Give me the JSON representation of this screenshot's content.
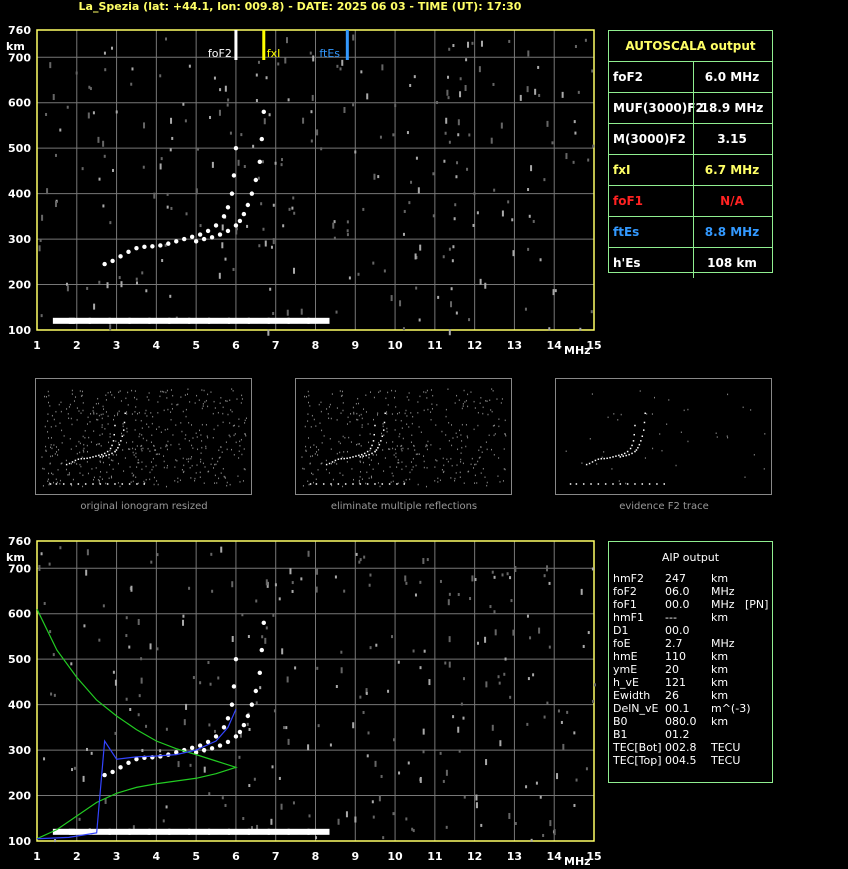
{
  "header": {
    "title": "La_Spezia (lat: +44.1, lon: 009.8) - DATE: 2025 06 03 - TIME (UT): 17:30"
  },
  "axes": {
    "x_label": "MHz",
    "y_label": "km",
    "x_ticks": [
      "1",
      "2",
      "3",
      "4",
      "5",
      "6",
      "7",
      "8",
      "9",
      "10",
      "11",
      "12",
      "13",
      "14",
      "15"
    ],
    "y_ticks": [
      "100",
      "200",
      "300",
      "400",
      "500",
      "600",
      "700",
      "760"
    ]
  },
  "markers": [
    {
      "label": "foF2",
      "freq": 6.0,
      "color": "#ffffff"
    },
    {
      "label": "fxI",
      "freq": 6.7,
      "color": "#ffff00"
    },
    {
      "label": "ftEs",
      "freq": 8.8,
      "color": "#3399ff"
    }
  ],
  "autoscala": {
    "title": "AUTOSCALA output",
    "rows": [
      {
        "key": "foF2",
        "value": "6.0 MHz",
        "color": "#ffffff"
      },
      {
        "key": "MUF(3000)F2",
        "value": "18.9 MHz",
        "color": "#ffffff"
      },
      {
        "key": "M(3000)F2",
        "value": "3.15",
        "color": "#ffffff"
      },
      {
        "key": "fxI",
        "value": "6.7 MHz",
        "color": "#ffff66"
      },
      {
        "key": "foF1",
        "value": "N/A",
        "color": "#ff2222"
      },
      {
        "key": "ftEs",
        "value": "8.8 MHz",
        "color": "#3399ff"
      },
      {
        "key": "h'Es",
        "value": "108     km",
        "color": "#ffffff"
      }
    ]
  },
  "captions": {
    "t1": "original ionogram resized",
    "t2": "eliminate multiple reflections",
    "t3": "evidence F2 trace"
  },
  "aip": {
    "title": "AIP output",
    "rows": [
      [
        "hmF2",
        "247",
        "km",
        ""
      ],
      [
        "foF2",
        "06.0",
        "MHz",
        ""
      ],
      [
        "foF1",
        "00.0",
        "MHz",
        "[PN]"
      ],
      [
        "hmF1",
        "---",
        "km",
        ""
      ],
      [
        "D1",
        "00.0",
        "",
        ""
      ],
      [
        "foE",
        "2.7",
        "MHz",
        ""
      ],
      [
        "hmE",
        "110",
        "km",
        ""
      ],
      [
        "ymE",
        "20",
        "km",
        ""
      ],
      [
        "h_vE",
        "121",
        "km",
        ""
      ],
      [
        "Ewidth",
        "26",
        "km",
        ""
      ],
      [
        "DelN_vE",
        "00.1",
        "m^(-3)",
        ""
      ],
      [
        "B0",
        "080.0",
        "km",
        ""
      ],
      [
        "B1",
        "01.2",
        "",
        ""
      ],
      [
        "TEC[Bot]",
        "002.8",
        "TECU",
        ""
      ],
      [
        "TEC[Top]",
        "004.5",
        "TECU",
        ""
      ]
    ]
  },
  "chart_data": [
    {
      "type": "scatter",
      "name": "ionogram",
      "x_unit": "MHz",
      "y_unit": "km",
      "xlim": [
        1,
        15
      ],
      "ylim": [
        100,
        760
      ],
      "grid": true,
      "series": [
        {
          "name": "ordinary F trace",
          "color": "#ffffff",
          "x": [
            2.7,
            2.9,
            3.1,
            3.3,
            3.5,
            3.7,
            3.9,
            4.1,
            4.3,
            4.5,
            4.7,
            4.9,
            5.1,
            5.3,
            5.5,
            5.7,
            5.8,
            5.9,
            5.95,
            6.0
          ],
          "y": [
            245,
            252,
            262,
            272,
            280,
            283,
            284,
            286,
            290,
            295,
            300,
            305,
            310,
            318,
            330,
            350,
            370,
            400,
            440,
            500
          ]
        },
        {
          "name": "extraordinary F trace",
          "color": "#ffffff",
          "x": [
            5.0,
            5.2,
            5.4,
            5.6,
            5.8,
            6.0,
            6.1,
            6.2,
            6.3,
            6.4,
            6.5,
            6.6,
            6.65,
            6.7
          ],
          "y": [
            295,
            300,
            304,
            310,
            318,
            330,
            340,
            355,
            375,
            400,
            430,
            470,
            520,
            580
          ]
        },
        {
          "name": "Es trace",
          "color": "#ffffff",
          "x": [
            1.6,
            2.0,
            2.5,
            3.0,
            3.5,
            4.0,
            4.5,
            5.0,
            5.5,
            6.0,
            6.5,
            7.0,
            7.5,
            8.0
          ],
          "y": [
            118,
            118,
            118,
            118,
            118,
            118,
            118,
            118,
            118,
            118,
            118,
            118,
            118,
            118
          ]
        }
      ]
    },
    {
      "type": "line",
      "name": "AIP profile",
      "x_unit": "MHz",
      "y_unit": "km",
      "xlim": [
        1,
        15
      ],
      "ylim": [
        100,
        760
      ],
      "grid": true,
      "series": [
        {
          "name": "electron density profile",
          "color": "#22cc22",
          "x": [
            1.0,
            1.5,
            2.0,
            2.5,
            3.0,
            3.5,
            4.0,
            4.5,
            5.0,
            5.5,
            6.0,
            5.5,
            5.0,
            4.5,
            4.0,
            3.5,
            3.0,
            2.5,
            2.0,
            1.5,
            1.0
          ],
          "y": [
            610,
            520,
            460,
            410,
            375,
            345,
            320,
            303,
            290,
            276,
            262,
            248,
            238,
            232,
            226,
            218,
            205,
            185,
            155,
            125,
            105
          ]
        },
        {
          "name": "true height profile",
          "color": "#3344ff",
          "x": [
            1.0,
            1.8,
            2.5,
            2.7,
            3.0,
            3.5,
            4.0,
            4.5,
            5.0,
            5.5,
            5.8,
            6.0
          ],
          "y": [
            105,
            108,
            118,
            320,
            280,
            285,
            287,
            290,
            300,
            320,
            350,
            390
          ]
        }
      ]
    }
  ]
}
